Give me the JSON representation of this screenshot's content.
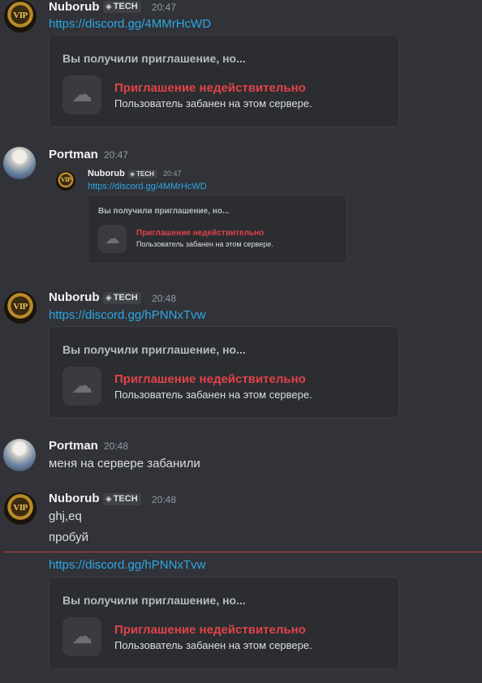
{
  "messages": [
    {
      "author": "Nuborub",
      "tag": "TECH",
      "time": "20:47",
      "link": "https://discord.gg/4MMrHcWD",
      "embed": {
        "header": "Вы получили приглашение, но...",
        "title": "Приглашение недействительно",
        "subtitle": "Пользователь забанен на этом сервере."
      }
    },
    {
      "author": "Portman",
      "time": "20:47",
      "quoted": {
        "author": "Nuborub",
        "tag": "TECH",
        "time": "20:47",
        "link": "https://discord.gg/4MMrHcWD",
        "embed": {
          "header": "Вы получили приглашение, но...",
          "title": "Приглашение недействительно",
          "subtitle": "Пользователь забанен на этом сервере."
        }
      }
    },
    {
      "author": "Nuborub",
      "tag": "TECH",
      "time": "20:48",
      "link": "https://discord.gg/hPNNxTvw",
      "embed": {
        "header": "Вы получили приглашение, но...",
        "title": "Приглашение недействительно",
        "subtitle": "Пользователь забанен на этом сервере."
      }
    },
    {
      "author": "Portman",
      "time": "20:48",
      "text": "меня на сервере забанили"
    },
    {
      "author": "Nuborub",
      "tag": "TECH",
      "time": "20:48",
      "lines": [
        "ghj,eq",
        "пробуй"
      ]
    },
    {
      "link": "https://discord.gg/hPNNxTvw",
      "embed": {
        "header": "Вы получили приглашение, но...",
        "title": "Приглашение недействительно",
        "subtitle": "Пользователь забанен на этом сервере."
      }
    }
  ],
  "avatar_badge": "VIP",
  "colors": {
    "background": "#313338",
    "embed_bg": "#2b2d31",
    "link": "#00a8fc",
    "invalid_red": "#e04348",
    "new_divider": "#f23f43"
  }
}
